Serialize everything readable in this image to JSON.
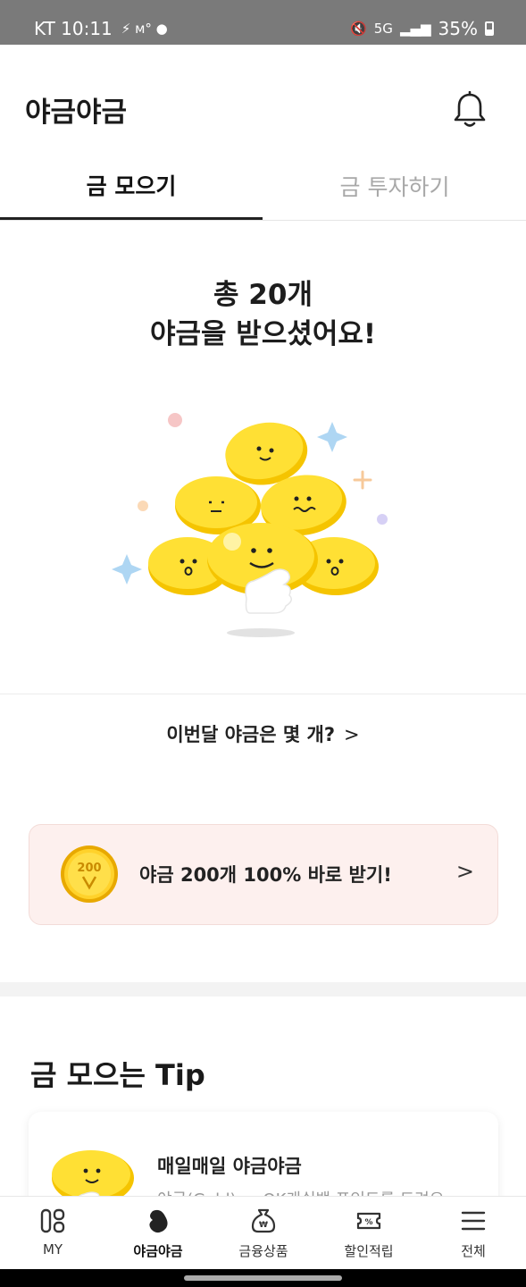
{
  "status_bar": {
    "carrier_time": "KT 10:11",
    "battery": "35%",
    "network": "5G"
  },
  "header": {
    "title": "야금야금"
  },
  "tabs": [
    {
      "label": "금 모으기",
      "active": true
    },
    {
      "label": "금 투자하기",
      "active": false
    }
  ],
  "hero": {
    "line1": "총 20개",
    "line2": "야금을 받으셨어요!"
  },
  "monthly_link": {
    "label": "이번달 야금은 몇 개?",
    "chevron": ">"
  },
  "promo": {
    "label": "야금 200개 100% 바로 받기!",
    "coin_text": "200",
    "chevron": ">"
  },
  "tips": {
    "heading": "금 모으는 Tip",
    "card_title": "매일매일 야금야금",
    "card_desc": "야금(Gold) or OK캐쉬백 포인트를 드려요"
  },
  "bottom_nav": [
    {
      "label": "MY",
      "icon": "my-grid-icon"
    },
    {
      "label": "야금야금",
      "icon": "bean-icon",
      "active": true
    },
    {
      "label": "금융상품",
      "icon": "money-bag-icon"
    },
    {
      "label": "할인적립",
      "icon": "coupon-icon"
    },
    {
      "label": "전체",
      "icon": "menu-icon"
    }
  ],
  "colors": {
    "accent_yellow": "#FFD41C",
    "promo_bg": "#FDF0EE"
  }
}
